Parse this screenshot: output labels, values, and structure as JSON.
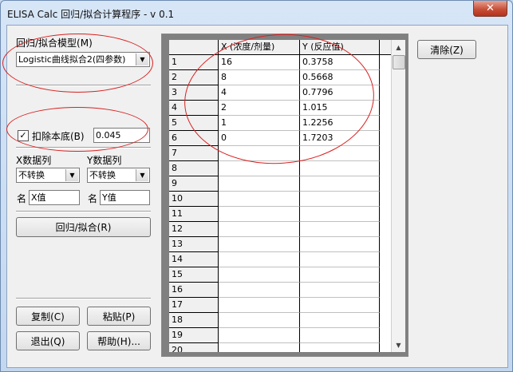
{
  "window": {
    "title": "ELISA Calc 回归/拟合计算程序 - v 0.1",
    "close_glyph": "✕"
  },
  "model": {
    "label": "回归/拟合模型(M)",
    "selected": "Logistic曲线拟合2(四参数)"
  },
  "background": {
    "checked": true,
    "label": "扣除本底(B)",
    "value": "0.045"
  },
  "x_col": {
    "label": "X数据列",
    "selected": "不转换",
    "name_label": "名",
    "name_value": "X值"
  },
  "y_col": {
    "label": "Y数据列",
    "selected": "不转换",
    "name_label": "名",
    "name_value": "Y值"
  },
  "buttons": {
    "regress": "回归/拟合(R)",
    "copy": "复制(C)",
    "paste": "粘贴(P)",
    "exit": "退出(Q)",
    "help": "帮助(H)...",
    "clear": "清除(Z)"
  },
  "grid": {
    "headers": {
      "x": "X (浓度/剂量)",
      "y": "Y (反应值)"
    },
    "rows": [
      {
        "n": "1",
        "x": "16",
        "y": "0.3758"
      },
      {
        "n": "2",
        "x": "8",
        "y": "0.5668"
      },
      {
        "n": "3",
        "x": "4",
        "y": "0.7796"
      },
      {
        "n": "4",
        "x": "2",
        "y": "1.015"
      },
      {
        "n": "5",
        "x": "1",
        "y": "1.2256"
      },
      {
        "n": "6",
        "x": "0",
        "y": "1.7203"
      },
      {
        "n": "7",
        "x": "",
        "y": ""
      },
      {
        "n": "8",
        "x": "",
        "y": ""
      },
      {
        "n": "9",
        "x": "",
        "y": ""
      },
      {
        "n": "10",
        "x": "",
        "y": ""
      },
      {
        "n": "11",
        "x": "",
        "y": ""
      },
      {
        "n": "12",
        "x": "",
        "y": ""
      },
      {
        "n": "13",
        "x": "",
        "y": ""
      },
      {
        "n": "14",
        "x": "",
        "y": ""
      },
      {
        "n": "15",
        "x": "",
        "y": ""
      },
      {
        "n": "16",
        "x": "",
        "y": ""
      },
      {
        "n": "17",
        "x": "",
        "y": ""
      },
      {
        "n": "18",
        "x": "",
        "y": ""
      },
      {
        "n": "19",
        "x": "",
        "y": ""
      },
      {
        "n": "20",
        "x": "",
        "y": ""
      }
    ]
  },
  "annotation_color": "#d92020"
}
